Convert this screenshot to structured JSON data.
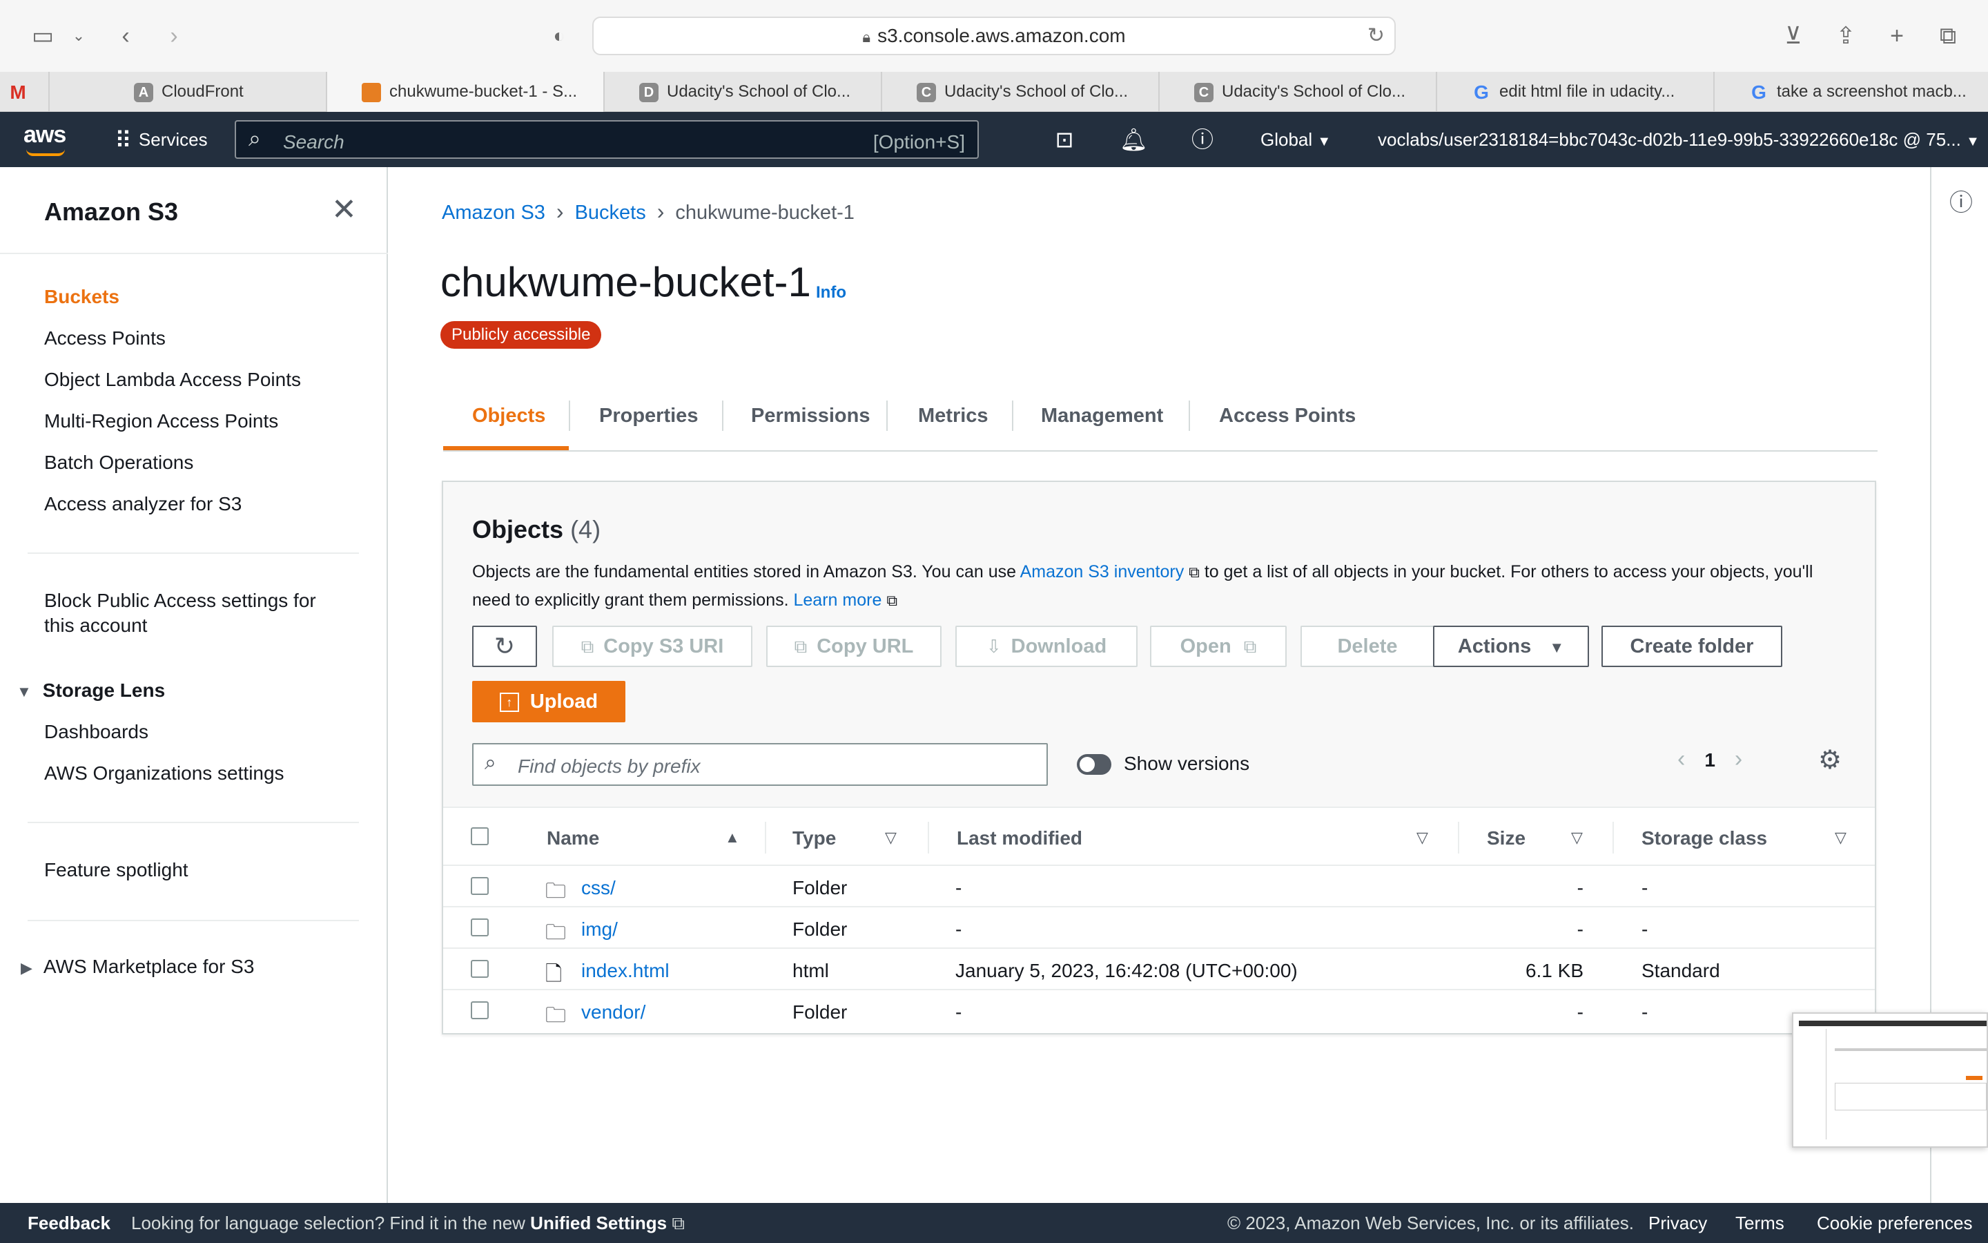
{
  "browser": {
    "url": "s3.console.aws.amazon.com",
    "tabs": [
      {
        "label": "",
        "icon": "gmail-icon"
      },
      {
        "label": "CloudFront",
        "icon_letter": "A"
      },
      {
        "label": "chukwume-bucket-1 - S...",
        "icon_letter": ""
      },
      {
        "label": "Udacity's School of Clo...",
        "icon_letter": "D"
      },
      {
        "label": "Udacity's School of Clo...",
        "icon_letter": "C"
      },
      {
        "label": "Udacity's School of Clo...",
        "icon_letter": "C"
      },
      {
        "label": "edit html file in udacity...",
        "icon_letter": "G"
      },
      {
        "label": "take a screenshot macb...",
        "icon_letter": "G"
      }
    ]
  },
  "aws_header": {
    "logo": "aws",
    "services": "Services",
    "search_placeholder": "Search",
    "search_hint": "[Option+S]",
    "region": "Global",
    "account": "voclabs/user2318184=bbc7043c-d02b-11e9-99b5-33922660e18c @ 75..."
  },
  "sidebar": {
    "title": "Amazon S3",
    "items": [
      {
        "label": "Buckets"
      },
      {
        "label": "Access Points"
      },
      {
        "label": "Object Lambda Access Points"
      },
      {
        "label": "Multi-Region Access Points"
      },
      {
        "label": "Batch Operations"
      },
      {
        "label": "Access analyzer for S3"
      }
    ],
    "block_public_line1": "Block Public Access settings for",
    "block_public_line2": "this account",
    "storage_lens": "Storage Lens",
    "storage_lens_items": [
      {
        "label": "Dashboards"
      },
      {
        "label": "AWS Organizations settings"
      }
    ],
    "feature_spotlight": "Feature spotlight",
    "marketplace": "AWS Marketplace for S3"
  },
  "breadcrumb": [
    "Amazon S3",
    "Buckets",
    "chukwume-bucket-1"
  ],
  "page": {
    "title": "chukwume-bucket-1",
    "info": "Info",
    "badge": "Publicly accessible"
  },
  "tabs": [
    "Objects",
    "Properties",
    "Permissions",
    "Metrics",
    "Management",
    "Access Points"
  ],
  "objects": {
    "title": "Objects",
    "count": "(4)",
    "desc_1": "Objects are the fundamental entities stored in Amazon S3. You can use ",
    "desc_link1": "Amazon S3 inventory",
    "desc_2": " to get a list of all objects in your bucket. For others to access your objects, you'll need to explicitly grant them permissions. ",
    "desc_link2": "Learn more",
    "buttons": {
      "copy_uri": "Copy S3 URI",
      "copy_url": "Copy URL",
      "download": "Download",
      "open": "Open",
      "delete": "Delete",
      "actions": "Actions",
      "create_folder": "Create folder",
      "upload": "Upload"
    },
    "find_placeholder": "Find objects by prefix",
    "show_versions": "Show versions",
    "page": "1",
    "columns": [
      "Name",
      "Type",
      "Last modified",
      "Size",
      "Storage class"
    ],
    "rows": [
      {
        "name": "css/",
        "type": "Folder",
        "modified": "-",
        "size": "-",
        "storage": "-",
        "icon": "folder-icon"
      },
      {
        "name": "img/",
        "type": "Folder",
        "modified": "-",
        "size": "-",
        "storage": "-",
        "icon": "folder-icon"
      },
      {
        "name": "index.html",
        "type": "html",
        "modified": "January 5, 2023, 16:42:08 (UTC+00:00)",
        "size": "6.1 KB",
        "storage": "Standard",
        "icon": "file-icon"
      },
      {
        "name": "vendor/",
        "type": "Folder",
        "modified": "-",
        "size": "-",
        "storage": "-",
        "icon": "folder-icon"
      }
    ]
  },
  "footer": {
    "feedback": "Feedback",
    "lang_text": "Looking for language selection? Find it in the new ",
    "unified": "Unified Settings",
    "copyright": "© 2023, Amazon Web Services, Inc. or its affiliates.",
    "privacy": "Privacy",
    "terms": "Terms",
    "cookies": "Cookie preferences"
  },
  "colors": {
    "aws_navy": "#232f3e",
    "accent_orange": "#ec7211",
    "link_blue": "#0972d3",
    "badge_red": "#d13212"
  }
}
